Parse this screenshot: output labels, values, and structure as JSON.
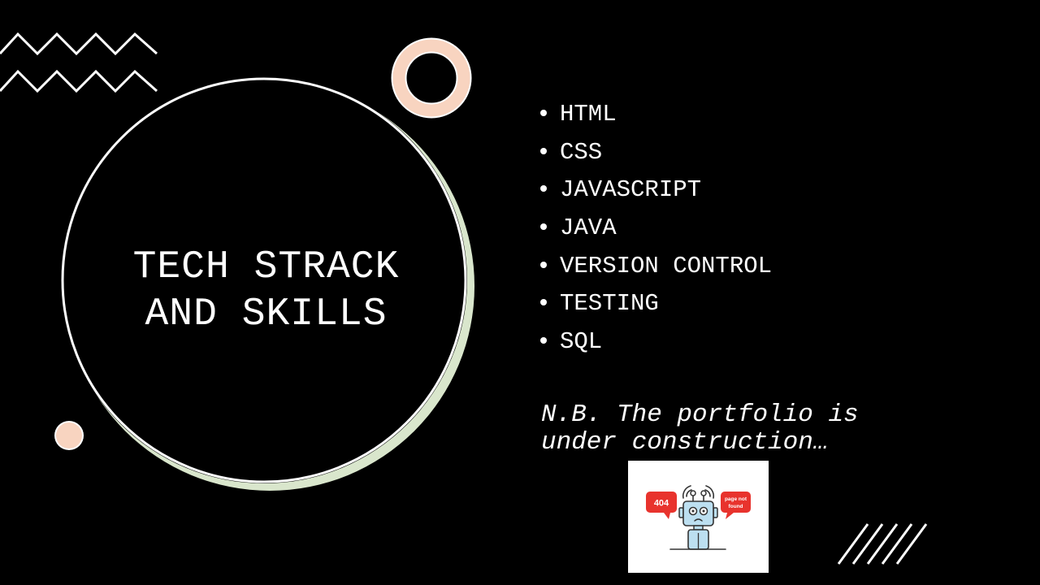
{
  "title": {
    "line1": "TECH STRACK",
    "line2": "AND SKILLS"
  },
  "skills": [
    "HTML",
    "CSS",
    "JAVASCRIPT",
    "JAVA",
    "VERSION CONTROL",
    "TESTING",
    "SQL"
  ],
  "note": "N.B. The portfolio is under construction…",
  "error_image": {
    "code_badge": "404",
    "message_line1": "page not",
    "message_line2": "found"
  },
  "colors": {
    "background": "#000000",
    "text": "#ffffff",
    "peach": "#f8d4c0",
    "sage": "#d9e6cc",
    "error_red": "#e8332d",
    "robot_blue": "#bcdff0"
  }
}
